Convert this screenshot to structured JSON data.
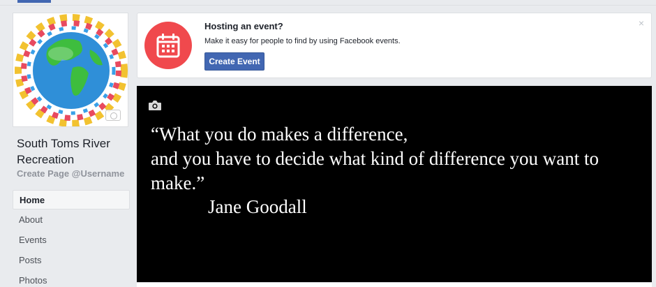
{
  "sidebar": {
    "page_name": "South Toms River Recreation",
    "username": "Create Page @Username",
    "nav_items": [
      {
        "label": "Home",
        "active": true
      },
      {
        "label": "About"
      },
      {
        "label": "Events"
      },
      {
        "label": "Posts"
      },
      {
        "label": "Photos"
      }
    ]
  },
  "event_prompt": {
    "title": "Hosting an event?",
    "description": "Make it easy for people to find by using Facebook events.",
    "button_label": "Create Event",
    "close_symbol": "×",
    "icon": "calendar-icon"
  },
  "cover": {
    "quote_lines": [
      "“What you do makes a difference,",
      "and you have to decide what kind of difference you want to make.”"
    ],
    "author": "Jane Goodall",
    "camera_icon": "camera-icon"
  },
  "colors": {
    "brand_blue": "#4267b2",
    "event_red": "#f0494d",
    "background": "#e9ebee"
  }
}
